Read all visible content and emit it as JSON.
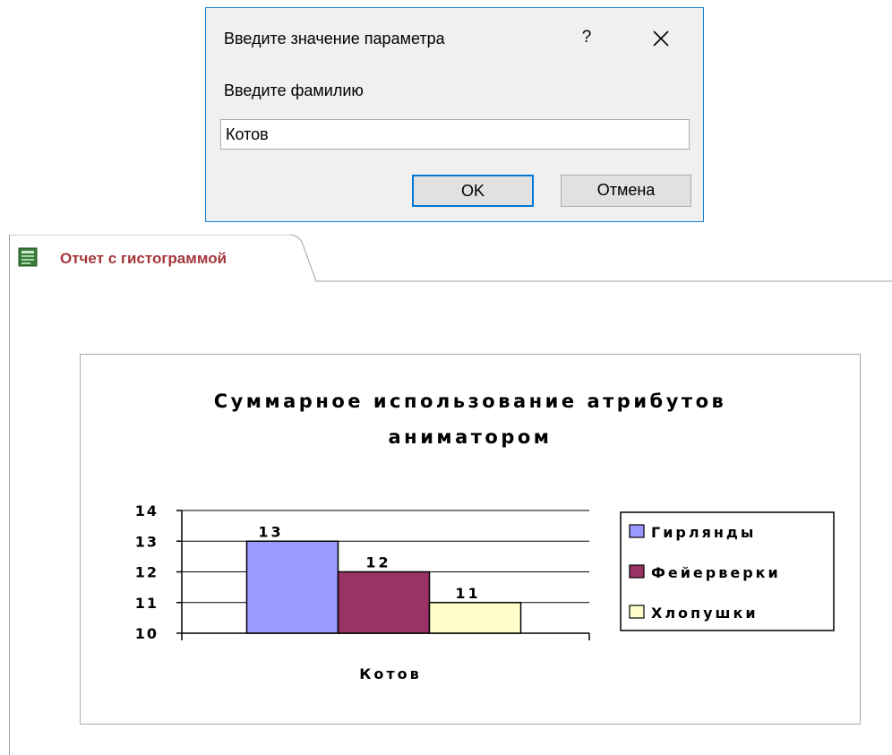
{
  "dialog": {
    "title": "Введите значение параметра",
    "help_label": "?",
    "prompt": "Введите фамилию",
    "input_value": "Котов",
    "ok_label": "OK",
    "cancel_label": "Отмена",
    "accent_color": "#1883d7"
  },
  "report": {
    "tab_label": "Отчет с гистограммой",
    "tab_icon": "report-icon",
    "tab_label_color": "#a4373a"
  },
  "chart_data": {
    "type": "bar",
    "title_lines": [
      "Суммарное использование атрибутов",
      "аниматором"
    ],
    "categories": [
      "Котов"
    ],
    "series": [
      {
        "name": "Гирлянды",
        "values": [
          13
        ],
        "color": "#9999ff"
      },
      {
        "name": "Фейерверки",
        "values": [
          12
        ],
        "color": "#993366"
      },
      {
        "name": "Хлопушки",
        "values": [
          11
        ],
        "color": "#ffffcc"
      }
    ],
    "ylim": [
      10,
      14
    ],
    "yticks": [
      "10",
      "11",
      "12",
      "13",
      "14"
    ],
    "grid": true,
    "data_labels": true,
    "legend": "right"
  }
}
